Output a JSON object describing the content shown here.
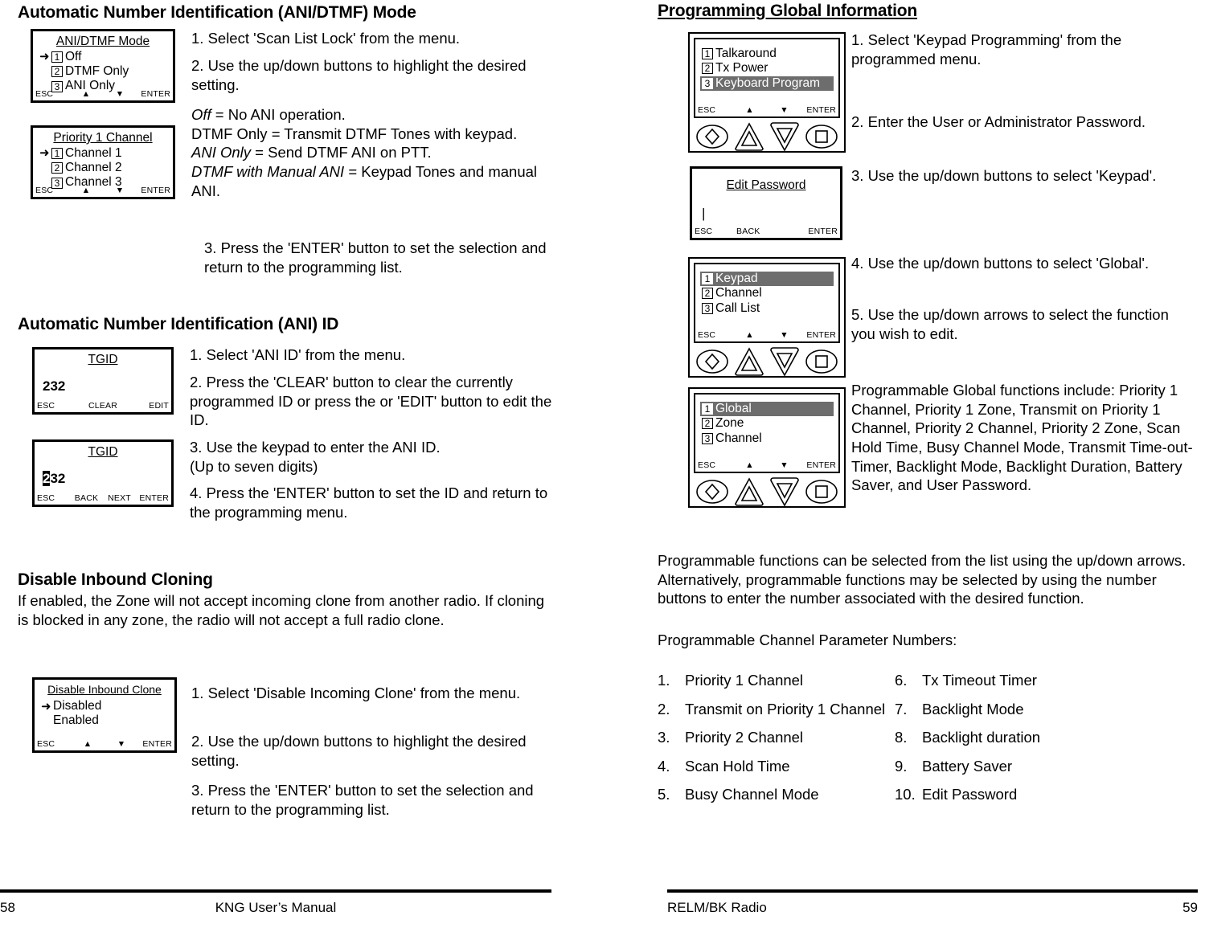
{
  "left_column": {
    "section1": {
      "heading": "Automatic Number Identification (ANI/DTMF) Mode",
      "screen_ani_mode": {
        "title": "ANI/DTMF Mode",
        "rows": [
          {
            "marker": "➜",
            "num": "1",
            "label": "Off"
          },
          {
            "marker": "",
            "num": "2",
            "label": "DTMF Only"
          },
          {
            "marker": "",
            "num": "3",
            "label": "ANI Only"
          }
        ],
        "softkeys": [
          "ESC",
          "▲",
          "▼",
          "ENTER"
        ]
      },
      "screen_priority1": {
        "title": "Priority 1 Channel",
        "rows": [
          {
            "marker": "➜",
            "num": "1",
            "label": "Channel 1"
          },
          {
            "marker": "",
            "num": "2",
            "label": "Channel 2"
          },
          {
            "marker": "",
            "num": "3",
            "label": "Channel 3"
          }
        ],
        "softkeys": [
          "ESC",
          "▲",
          "▼",
          "ENTER"
        ]
      },
      "step1": "1.    Select 'Scan List Lock' from the menu.",
      "step2": "2.   Use the up/down buttons to highlight the desired setting.",
      "def1_term": "Off",
      "def1_rest": " = No ANI operation.",
      "def2": "DTMF Only = Transmit DTMF Tones with keypad.",
      "def3_term": "ANI Only",
      "def3_rest": " = Send DTMF ANI on PTT.",
      "def4_term": "DTMF with Manual ANI",
      "def4_rest": " = Keypad Tones and manual ANI.",
      "step3": "3.   Press the 'ENTER' button to set the selection and return to the programming list."
    },
    "section2": {
      "heading": "Automatic Number Identification (ANI) ID",
      "screen_tgid_view": {
        "title": "TGID",
        "value": "232",
        "softkeys": [
          "ESC",
          "CLEAR",
          "EDIT"
        ]
      },
      "screen_tgid_edit": {
        "title": "TGID",
        "value_cursor": "2",
        "value_rest": "32",
        "softkeys": [
          "ESC",
          "BACK",
          "NEXT",
          "ENTER"
        ]
      },
      "step1": "1.   Select 'ANI ID' from the menu.",
      "step2": "2.   Press the 'CLEAR' button to clear the currently programmed ID or press the or 'EDIT' button to edit the ID.",
      "step3": "3.  Use the keypad to enter the ANI ID.\n(Up to seven digits)",
      "step4": "4.  Press the 'ENTER' button to set the ID and return to the programming menu."
    },
    "section3": {
      "heading": "Disable Inbound Cloning",
      "intro": "If enabled, the Zone will not accept incoming clone from another radio. If cloning is blocked in any zone, the radio will not accept a full radio clone.",
      "screen_clone": {
        "title": "Disable Inbound Clone",
        "rows": [
          {
            "marker": "➜",
            "num": "",
            "label": "Disabled"
          },
          {
            "marker": "",
            "num": "",
            "label": "Enabled"
          }
        ],
        "softkeys": [
          "ESC",
          "▲",
          "▼",
          "ENTER"
        ]
      },
      "step1": "1.   Select 'Disable Incoming Clone' from the menu.",
      "step2": "2.   Use the up/down buttons to highlight the desired setting.",
      "step3": "3.   Press the 'ENTER' button to set the selection and return to the programming list."
    }
  },
  "right_column": {
    "heading": "Programming Global Information",
    "screen_menu": {
      "rows": [
        {
          "num": "1",
          "label": "Talkaround",
          "selected": false
        },
        {
          "num": "2",
          "label": "Tx Power",
          "selected": false
        },
        {
          "num": "3",
          "label": "Keyboard Program",
          "selected": true
        }
      ],
      "softkeys": [
        "ESC",
        "▲",
        "▼",
        "ENTER"
      ],
      "buttons": [
        "diamond-button",
        "up-arrow-button",
        "down-arrow-button",
        "square-button"
      ]
    },
    "screen_password": {
      "title": "Edit Password",
      "value": "|",
      "softkeys": [
        "ESC",
        "BACK",
        "",
        "ENTER"
      ]
    },
    "screen_keypad": {
      "rows": [
        {
          "num": "1",
          "label": "Keypad",
          "selected": true
        },
        {
          "num": "2",
          "label": "Channel",
          "selected": false
        },
        {
          "num": "3",
          "label": "Call List",
          "selected": false
        }
      ],
      "softkeys": [
        "ESC",
        "▲",
        "▼",
        "ENTER"
      ],
      "buttons": [
        "diamond-button",
        "up-arrow-button",
        "down-arrow-button",
        "square-button"
      ]
    },
    "screen_global": {
      "rows": [
        {
          "num": "1",
          "label": "Global",
          "selected": true
        },
        {
          "num": "2",
          "label": "Zone",
          "selected": false
        },
        {
          "num": "3",
          "label": "Channel",
          "selected": false
        }
      ],
      "softkeys": [
        "ESC",
        "▲",
        "▼",
        "ENTER"
      ],
      "buttons": [
        "diamond-button",
        "up-arrow-button",
        "down-arrow-button",
        "square-button"
      ]
    },
    "step1": "1.    Select 'Keypad Programming' from the programmed menu.",
    "step2": "2.    Enter the User or Administrator Password.",
    "step3": "3.    Use the up/down buttons to select 'Keypad'.",
    "step4": "4.    Use the up/down buttons to select  'Global'.",
    "step5": "5.    Use the up/down arrows to select the function you wish to edit.",
    "functions_paragraph": "Programmable Global functions include: Priority 1 Channel, Priority 1 Zone, Transmit on Priority 1 Channel, Priority 2 Channel, Priority 2 Zone, Scan Hold Time, Busy Channel Mode, Transmit Time-out-Timer, Backlight Mode, Backlight Duration, Battery Saver, and User Password.",
    "selection_paragraph": "Programmable functions can be selected from the list using the up/down arrows. Alternatively, programmable functions may be selected by using the number buttons to enter the number associated with the desired function.",
    "param_heading": "Programmable Channel Parameter Numbers:",
    "params_left": [
      {
        "num": "1.",
        "label": "Priority 1 Channel"
      },
      {
        "num": "2.",
        "label": "Transmit on Priority 1 Channel"
      },
      {
        "num": "3.",
        "label": " Priority 2 Channel"
      },
      {
        "num": "4.",
        "label": "Scan Hold Time"
      },
      {
        "num": "5.",
        "label": "Busy Channel Mode"
      }
    ],
    "params_right": [
      {
        "num": "6.",
        "label": "Tx Timeout Timer"
      },
      {
        "num": "7.",
        "label": "Backlight Mode"
      },
      {
        "num": "8.",
        "label": "Backlight duration"
      },
      {
        "num": "9.",
        "label": "Battery Saver"
      },
      {
        "num": "10.",
        "label": "Edit Password"
      }
    ]
  },
  "footer": {
    "left_page": "58",
    "left_title": "KNG User’s Manual",
    "right_title": "RELM/BK Radio",
    "right_page": "59"
  }
}
